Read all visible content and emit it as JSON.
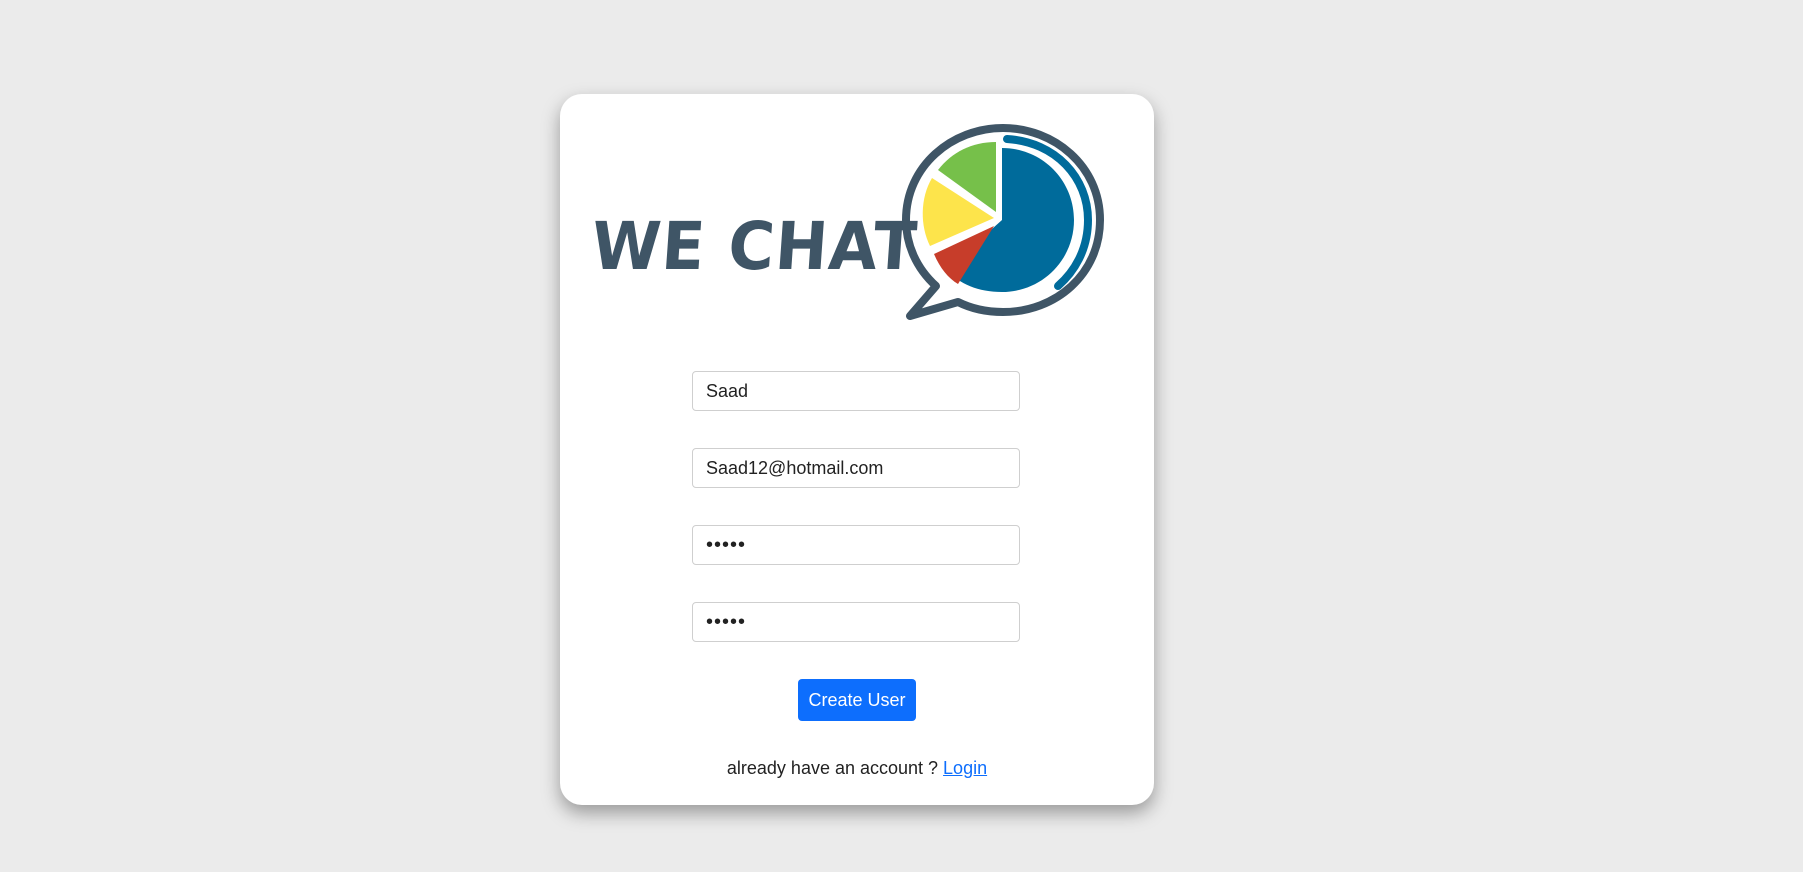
{
  "brand": {
    "title": "WE CHAT",
    "logo_icon": "chat-bubble-pie-chart-icon",
    "colors": {
      "text": "#3f5566",
      "outline": "#3f5566",
      "blue": "#006b9b",
      "green": "#76c04a",
      "yellow": "#fde44b",
      "red": "#c73d2a"
    }
  },
  "form": {
    "username": {
      "value": "Saad"
    },
    "email": {
      "value": "Saad12@hotmail.com"
    },
    "password": {
      "value": "•••••"
    },
    "confirm_password": {
      "value": "•••••"
    },
    "submit_label": "Create User"
  },
  "footer": {
    "prompt": "already have an account ? ",
    "link_label": "Login"
  },
  "colors": {
    "background": "#ebebeb",
    "card": "#ffffff",
    "accent": "#0d6efd"
  }
}
